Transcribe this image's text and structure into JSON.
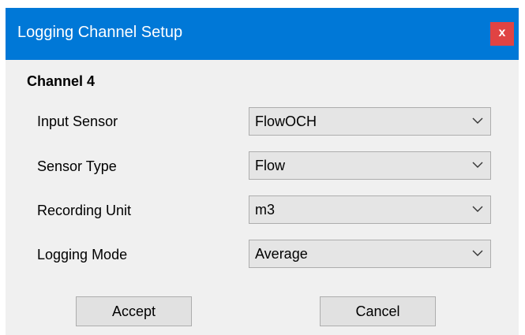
{
  "window": {
    "title": "Logging Channel Setup",
    "close_label": "x",
    "accent_color": "#0078d7",
    "close_color": "#e04343"
  },
  "channel": {
    "heading": "Channel 4"
  },
  "fields": [
    {
      "label": "Input Sensor",
      "value": "FlowOCH"
    },
    {
      "label": "Sensor Type",
      "value": "Flow"
    },
    {
      "label": "Recording Unit",
      "value": "m3"
    },
    {
      "label": "Logging Mode",
      "value": "Average"
    }
  ],
  "buttons": {
    "accept": "Accept",
    "cancel": "Cancel"
  },
  "icons": {
    "dropdown": "chevron-down-icon"
  }
}
